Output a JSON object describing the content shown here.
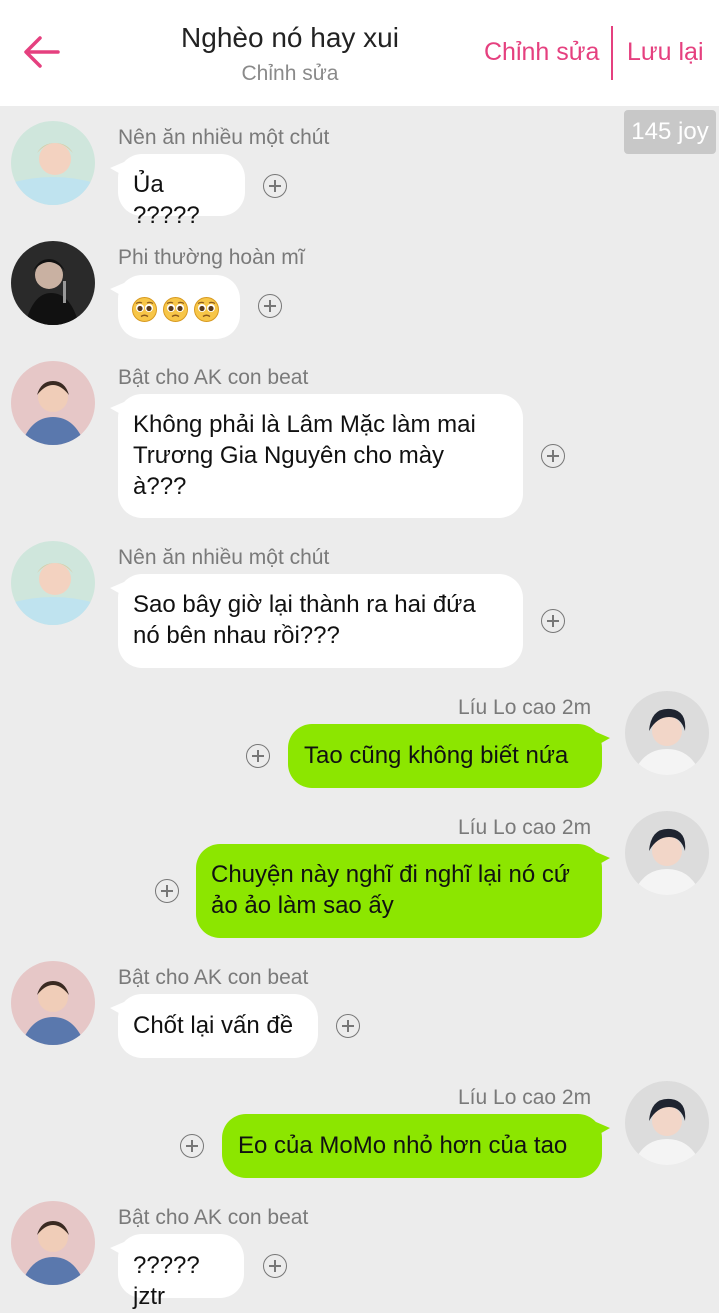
{
  "header": {
    "title": "Nghèo nó hay xui",
    "subtitle": "Chỉnh sửa",
    "edit_label": "Chỉnh sửa",
    "save_label": "Lưu lại",
    "back_icon": "back-arrow-icon",
    "accent_color": "#e5407f"
  },
  "badge": {
    "text": "145 joy"
  },
  "colors": {
    "outgoing_bubble": "#8ce600",
    "incoming_bubble": "#ffffff",
    "background": "#ececec"
  },
  "messages": [
    {
      "sender": "Nên ăn nhiều một chút",
      "text": "Ủa ?????",
      "direction": "incoming"
    },
    {
      "sender": "Phi thường hoàn mĩ",
      "text": "",
      "emoji": [
        "pleading-face-icon",
        "pleading-face-icon",
        "pleading-face-icon"
      ],
      "direction": "incoming"
    },
    {
      "sender": "Bật cho AK con beat",
      "lines": [
        "Không phải là Lâm Mặc làm mai",
        "Trương Gia Nguyên cho mày",
        "à???"
      ],
      "direction": "incoming"
    },
    {
      "sender": "Nên ăn nhiều một chút",
      "lines": [
        "Sao bây giờ lại thành ra hai đứa",
        "nó bên nhau rồi???"
      ],
      "direction": "incoming"
    },
    {
      "sender": "Líu Lo cao 2m",
      "text": "Tao cũng không biết nứa",
      "direction": "outgoing"
    },
    {
      "sender": "Líu Lo cao 2m",
      "lines": [
        "Chuyện này nghĩ đi nghĩ lại nó cứ",
        "ảo ảo làm sao ấy"
      ],
      "direction": "outgoing"
    },
    {
      "sender": "Bật cho AK con beat",
      "text": "Chốt lại vấn đề",
      "direction": "incoming"
    },
    {
      "sender": "Líu Lo cao 2m",
      "text": "Eo của MoMo nhỏ hơn của tao",
      "direction": "outgoing"
    },
    {
      "sender": "Bật cho AK con beat",
      "text": "?????jztr",
      "direction": "incoming"
    }
  ]
}
